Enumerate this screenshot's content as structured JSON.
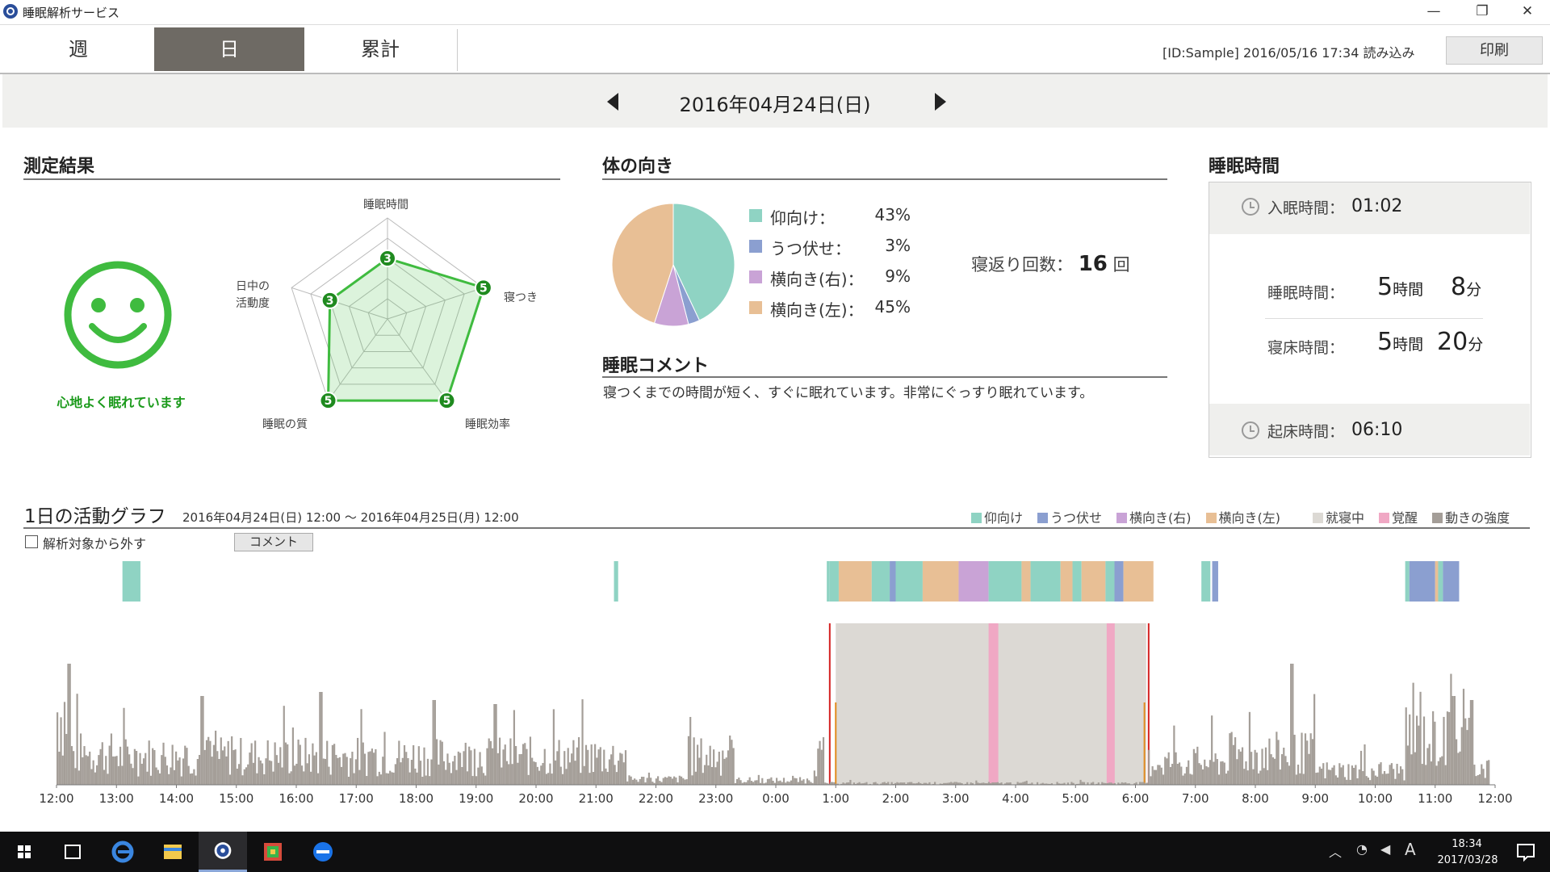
{
  "window": {
    "title": "睡眠解析サービス",
    "min": "—",
    "restore": "❐",
    "close": "✕"
  },
  "tabs": [
    "週",
    "日",
    "累計"
  ],
  "active_tab": "日",
  "header": {
    "id_info": "[ID:Sample]  2016/05/16 17:34 読み込み",
    "print": "印刷"
  },
  "date": "2016年04月24日(日)",
  "measurement": {
    "title": "測定結果",
    "face_caption": "心地よく眠れています",
    "radar": {
      "axes": [
        {
          "label": "睡眠時間",
          "score": 3
        },
        {
          "label": "寝つき",
          "score": 5
        },
        {
          "label": "睡眠効率",
          "score": 5
        },
        {
          "label": "睡眠の質",
          "score": 5
        },
        {
          "label": "日中の\n活動度",
          "score": 3
        }
      ],
      "max": 5
    }
  },
  "posture": {
    "title": "体の向き",
    "items": [
      {
        "label": "仰向け：",
        "pct": "43%",
        "value": 43,
        "color": "#8fd3c3"
      },
      {
        "label": "うつ伏せ：",
        "pct": "3%",
        "value": 3,
        "color": "#8b9fd0"
      },
      {
        "label": "横向き(右)：",
        "pct": "9%",
        "value": 9,
        "color": "#c9a3d6"
      },
      {
        "label": "横向き(左)：",
        "pct": "45%",
        "value": 45,
        "color": "#e8bf95"
      }
    ],
    "rollover_label": "寝返り回数：",
    "rollover_count": "16",
    "rollover_unit": "回"
  },
  "comment": {
    "title": "睡眠コメント",
    "text": "寝つくまでの時間が短く、すぐに眠れています。非常にぐっすり眠れています。"
  },
  "sleep_time": {
    "title": "睡眠時間",
    "onset_label": "入眠時間：",
    "onset_value": "01:02",
    "sleep_label": "睡眠時間：",
    "sleep_h": "5",
    "sleep_h_unit": "時間",
    "sleep_m": "8",
    "sleep_m_unit": "分",
    "bed_label": "寝床時間：",
    "bed_h": "5",
    "bed_h_unit": "時間",
    "bed_m": "20",
    "bed_m_unit": "分",
    "wake_label": "起床時間：",
    "wake_value": "06:10"
  },
  "activity": {
    "title": "1日の活動グラフ",
    "range": "2016年04月24日(日) 12:00 ～ 2016年04月25日(月) 12:00",
    "legend": [
      {
        "label": "仰向け",
        "color": "#8fd3c3"
      },
      {
        "label": "うつ伏せ",
        "color": "#8b9fd0"
      },
      {
        "label": "横向き(右)",
        "color": "#c9a3d6"
      },
      {
        "label": "横向き(左)",
        "color": "#e8bf95"
      },
      {
        "label": "就寝中",
        "color": "#dcd9d4"
      },
      {
        "label": "覚醒",
        "color": "#f0a8c4"
      },
      {
        "label": "動きの強度",
        "color": "#a49e98"
      }
    ],
    "exclude_label": "解析対象から外す",
    "comment_button": "コメント",
    "x_ticks": [
      "12:00",
      "13:00",
      "14:00",
      "15:00",
      "16:00",
      "17:00",
      "18:00",
      "19:00",
      "20:00",
      "21:00",
      "22:00",
      "23:00",
      "0:00",
      "1:00",
      "2:00",
      "3:00",
      "4:00",
      "5:00",
      "6:00",
      "7:00",
      "8:00",
      "9:00",
      "10:00",
      "11:00",
      "12:00"
    ]
  },
  "taskbar": {
    "time": "18:34",
    "date": "2017/03/28",
    "ime": "A"
  },
  "icons": [
    "windows-start-icon",
    "task-view-icon",
    "edge-icon",
    "file-explorer-icon",
    "sleep-app-icon",
    "paint-icon",
    "teamviewer-icon"
  ]
}
